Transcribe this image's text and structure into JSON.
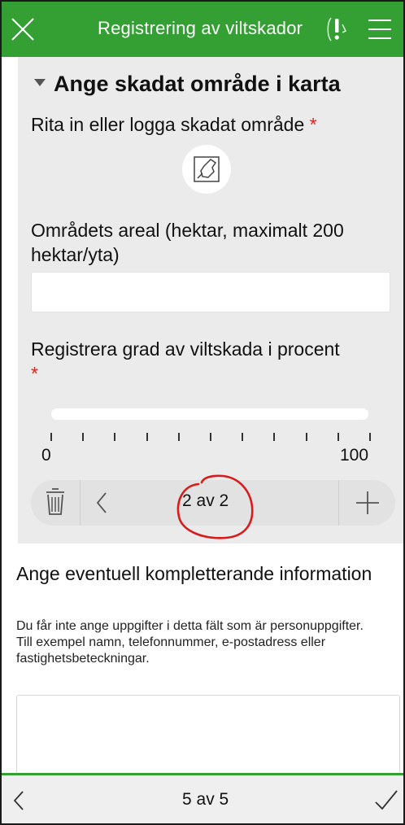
{
  "header": {
    "title": "Registrering av viltskador",
    "close_icon": "close-icon",
    "gps_icon": "gps-warning-icon",
    "menu_icon": "hamburger-menu-icon",
    "color": "#34a033"
  },
  "group": {
    "title": "Ange skadat område i karta",
    "draw_question": "Rita in eller logga skadat område",
    "required_mark": "*",
    "map_button_icon": "map-polygon-icon",
    "area_question": "Områdets areal (hektar, maximalt 200 hektar/yta)",
    "area_value": "",
    "slider_question": "Registrera grad av viltskada i procent",
    "slider_min_label": "0",
    "slider_max_label": "100",
    "repeat": {
      "label": "2 av 2",
      "delete_icon": "trash-icon",
      "prev_icon": "chevron-left-icon",
      "add_icon": "plus-icon"
    }
  },
  "info": {
    "question": "Ange eventuell kompletterande information",
    "hint": "Du får inte ange uppgifter i detta fält som är personuppgifter. Till exempel namn, telefonnummer, e-postadress eller fastighetsbeteckningar.",
    "value": ""
  },
  "footer": {
    "page_label": "5 av 5",
    "prev_icon": "chevron-left-icon",
    "submit_icon": "checkmark-icon"
  }
}
